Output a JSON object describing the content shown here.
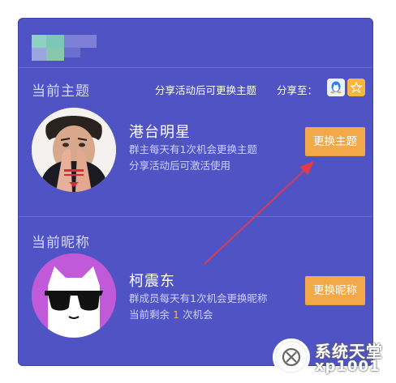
{
  "theme_section": {
    "title": "当前主题",
    "share_text": "分享活动后可更换主题",
    "share_to_label": "分享至：",
    "share_icons": [
      "qq-icon",
      "qzone-star-icon"
    ],
    "avatar": "celebrity-avatar",
    "name": "港台明星",
    "desc_line1": "群主每天有1次机会更换主题",
    "desc_line2": "分享活动后可激活使用",
    "button_label": "更换主题"
  },
  "nickname_section": {
    "title": "当前昵称",
    "avatar": "cat-sunglasses-avatar",
    "name": "柯震东",
    "desc_line1": "群成员每天有1次机会更换昵称",
    "remaining_prefix": "当前剩余",
    "remaining_count": "1",
    "remaining_suffix": "次机会",
    "button_label": "更换昵称"
  },
  "watermark": {
    "cn": "系统天堂",
    "en": "xp1001"
  },
  "colors": {
    "panel_bg": "#4f53c4",
    "button_bg": "#f3a84a",
    "count_highlight": "#f5b545",
    "arrow": "#e03b4b"
  }
}
